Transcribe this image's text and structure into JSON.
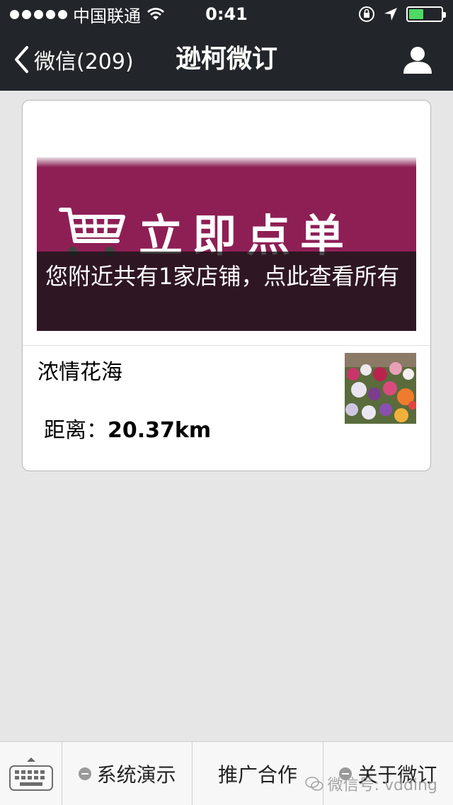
{
  "status_bar": {
    "carrier": "中国联通",
    "time": "0:41",
    "battery_level": 0.45,
    "battery_color": "#4cd964"
  },
  "nav": {
    "back_label": "微信(209)",
    "title": "逊柯微订",
    "profile_icon": "person-icon"
  },
  "banner": {
    "art_text": "立即点单",
    "caption": "您附近共有1家店铺，点此查看所有",
    "background_color": "#8e1f55"
  },
  "shop": {
    "name": "浓情花海",
    "distance_label": "距离：",
    "distance_value": "20.37km"
  },
  "toolbar": {
    "keyboard_icon": "keyboard-icon",
    "items": [
      {
        "label": "系统演示",
        "has_menu_icon": true
      },
      {
        "label": "推广合作",
        "has_menu_icon": false
      },
      {
        "label": "关于微订",
        "has_menu_icon": true
      }
    ]
  },
  "watermark": {
    "text": "微信号: vdding"
  }
}
